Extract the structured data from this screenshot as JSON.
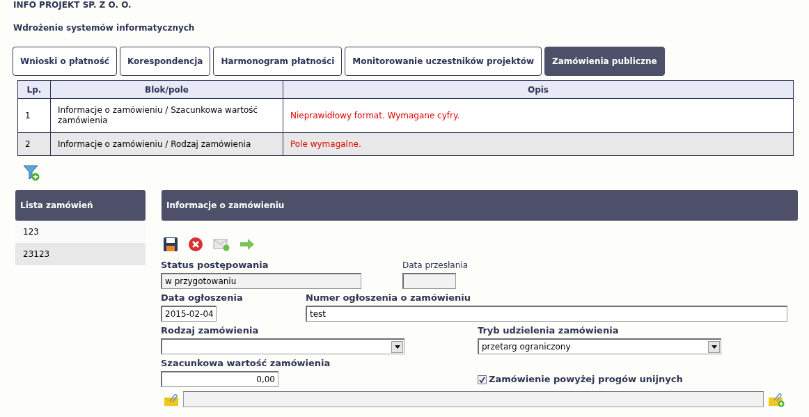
{
  "company": "INFO PROJEKT SP. Z O. O.",
  "project": "Wdrożenie systemów informatycznych",
  "tabs": [
    {
      "label": "Wnioski o płatność",
      "selected": false
    },
    {
      "label": "Korespondencja",
      "selected": false
    },
    {
      "label": "Harmonogram płatności",
      "selected": false
    },
    {
      "label": "Monitorowanie uczestników projektów",
      "selected": false
    },
    {
      "label": "Zamówienia publiczne",
      "selected": true
    }
  ],
  "errors_table": {
    "columns": [
      "Lp.",
      "Blok/pole",
      "Opis"
    ],
    "rows": [
      {
        "lp": "1",
        "field": "Informacje o zamówieniu / Szacunkowa wartość zamówienia",
        "description": "Nieprawidłowy format. Wymagane cyfry."
      },
      {
        "lp": "2",
        "field": "Informacje o zamówieniu / Rodzaj zamówienia",
        "description": "Pole wymagalne."
      }
    ]
  },
  "order_list": {
    "title": "Lista zamówień",
    "items": [
      "123",
      "23123"
    ]
  },
  "details": {
    "title": "Informacje o zamówieniu",
    "status": {
      "label": "Status postępowania",
      "value": "w przygotowaniu"
    },
    "sent_date": {
      "label": "Data przesłania"
    },
    "announcement_date": {
      "label": "Data ogłoszenia",
      "value": "2015-02-04"
    },
    "announcement_number": {
      "label": "Numer ogłoszenia o zamówieniu",
      "value": "test"
    },
    "order_type": {
      "label": "Rodzaj zamówienia"
    },
    "procedure_mode": {
      "label": "Tryb udzielenia zamówienia",
      "value": "przetarg ograniczony"
    },
    "estimated_value": {
      "label": "Szacunkowa wartość zamówienia",
      "value": "0,00"
    },
    "above_eu_thresholds": {
      "label": "Zamówienie powyżej progów unijnych",
      "checked": true
    }
  }
}
